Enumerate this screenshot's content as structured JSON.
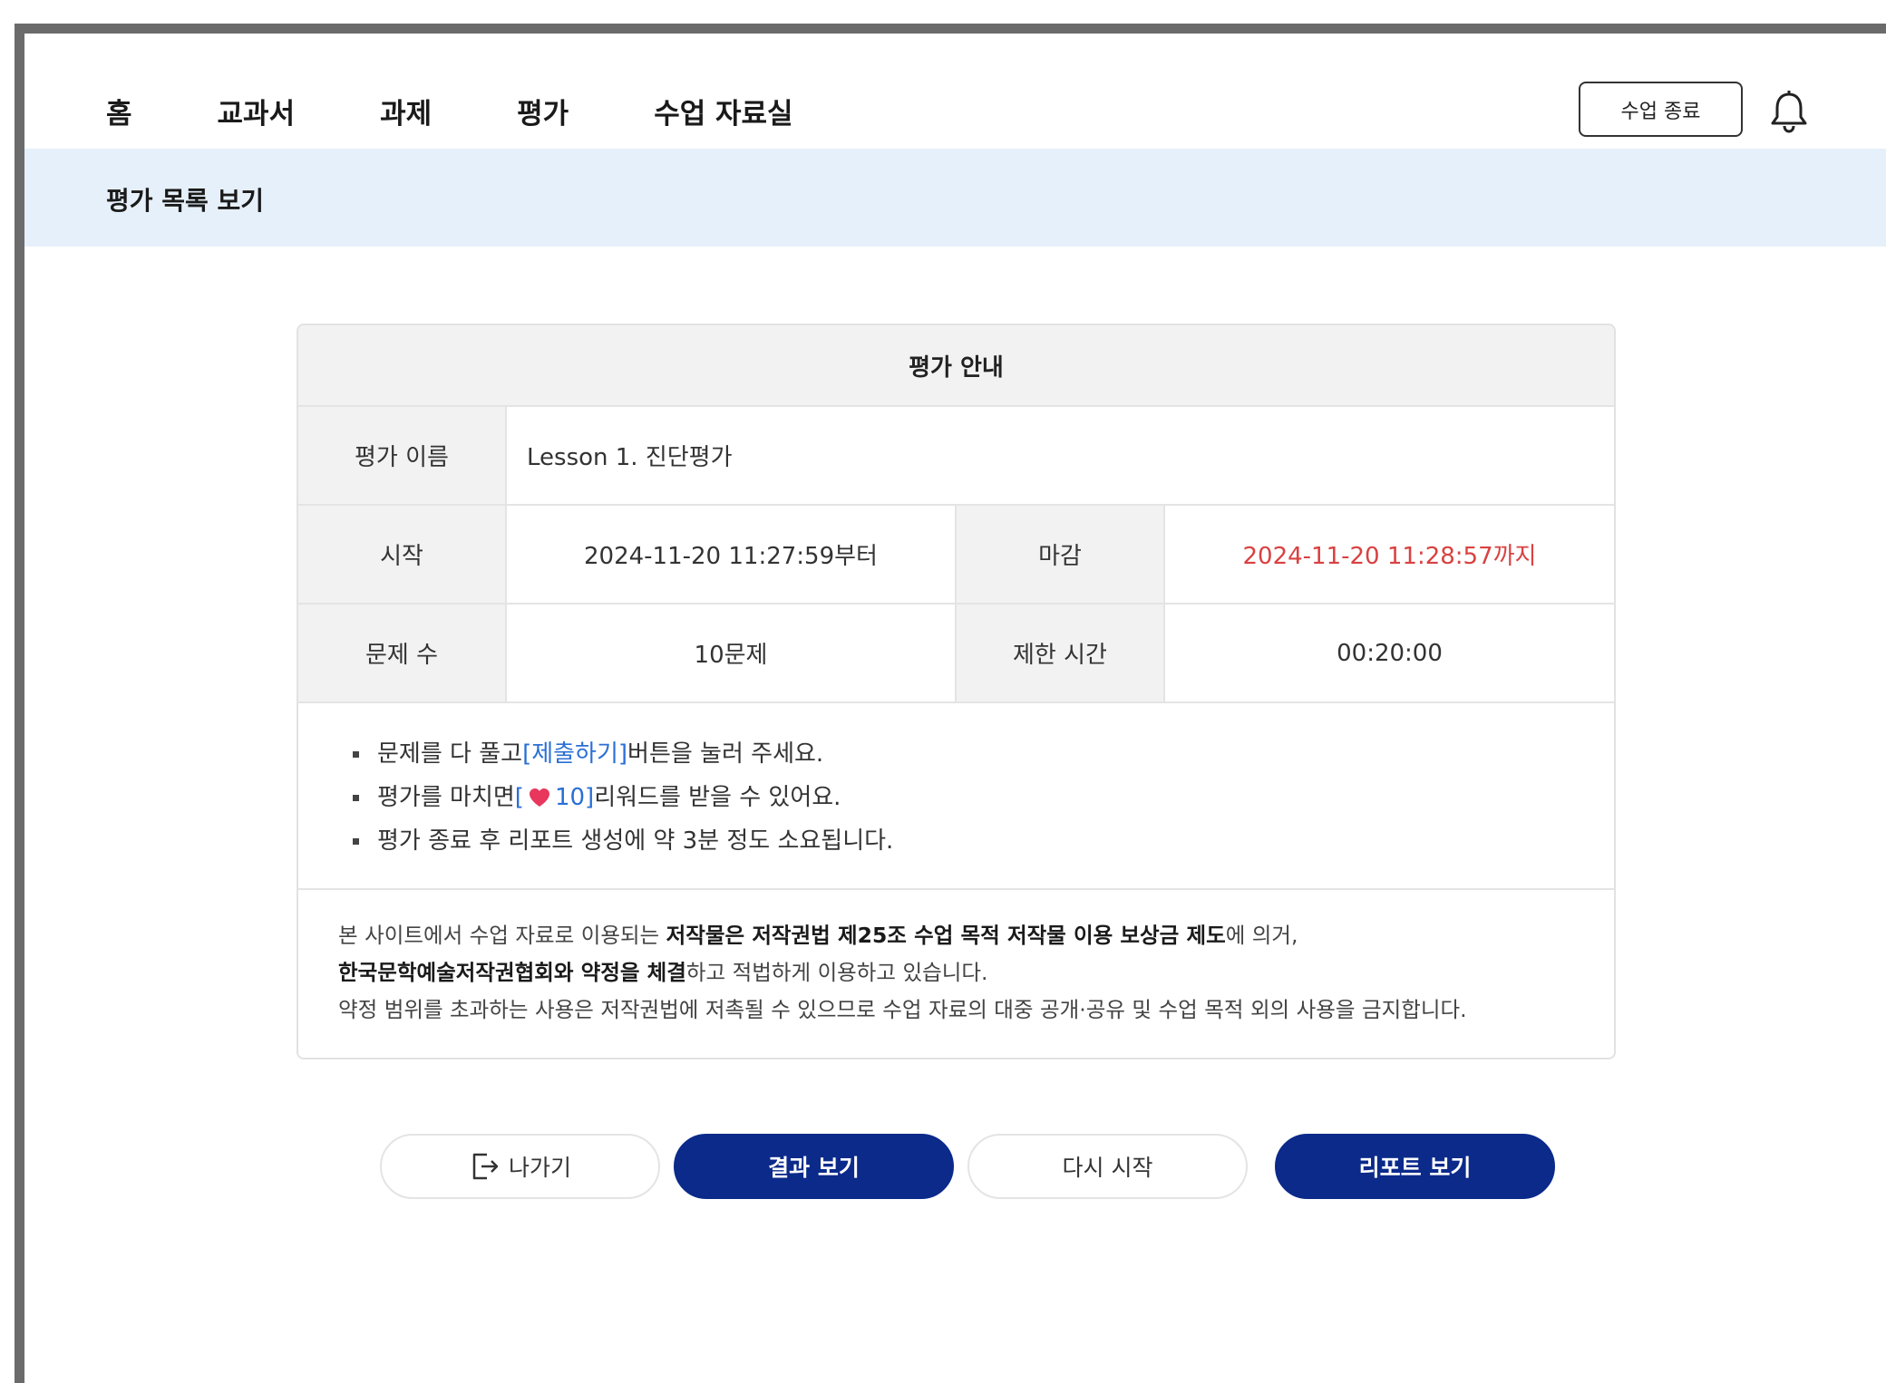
{
  "nav": {
    "items": [
      "홈",
      "교과서",
      "과제",
      "평가",
      "수업 자료실"
    ],
    "end_class_label": "수업 종료",
    "bell_icon": "bell-icon"
  },
  "subheader": {
    "title": "평가 목록 보기"
  },
  "card": {
    "header": "평가 안내",
    "name_label": "평가 이름",
    "name_value": "Lesson 1. 진단평가",
    "start_label": "시작",
    "start_value": "2024-11-20 11:27:59부터",
    "deadline_label": "마감",
    "deadline_value": "2024-11-20 11:28:57까지",
    "question_count_label": "문제 수",
    "question_count_value": "10문제",
    "time_limit_label": "제한 시간",
    "time_limit_value": "00:20:00",
    "notes": {
      "note1_pre": "문제를 다 풀고 ",
      "note1_link": "[제출하기]",
      "note1_post": " 버튼을 눌러 주세요.",
      "note2_pre": "평가를 마치면 ",
      "note2_reward_open": "[",
      "note2_reward_value": "10]",
      "note2_post": " 리워드를 받을 수 있어요.",
      "note3": "평가 종료 후 리포트 생성에 약 3분 정도 소요됩니다."
    },
    "copyright": {
      "line1_pre": "본 사이트에서 수업 자료로 이용되는 ",
      "line1_bold": "저작물은 저작권법 제25조 수업 목적 저작물 이용 보상금 제도",
      "line1_post": "에 의거,",
      "line2_bold": "한국문학예술저작권협회와 약정을 체결",
      "line2_post": "하고 적법하게 이용하고 있습니다.",
      "line3": "약정 범위를 초과하는 사용은 저작권법에 저촉될 수 있으므로 수업 자료의 대중 공개·공유 및 수업 목적 외의 사용을 금지합니다."
    }
  },
  "buttons": {
    "exit": "나가기",
    "results": "결과 보기",
    "restart": "다시 시작",
    "report": "리포트 보기"
  },
  "colors": {
    "primary": "#0b2a8a",
    "deadline": "#d94141",
    "link": "#2a6fd6",
    "subheader_bg": "#e6f0fa",
    "heart": "#e8365d"
  }
}
